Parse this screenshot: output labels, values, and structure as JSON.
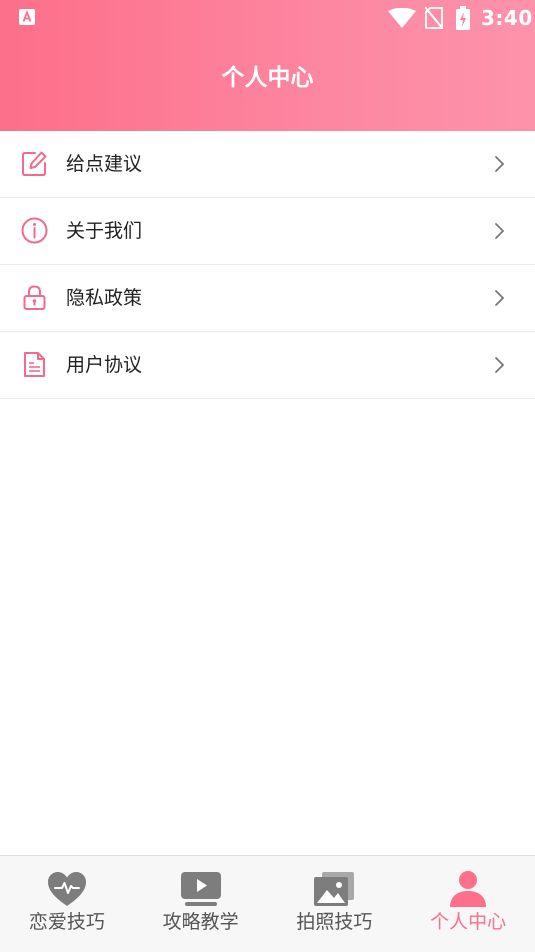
{
  "status_bar": {
    "time": "3:40",
    "app_icon": "app-a-icon",
    "wifi_icon": "wifi-icon",
    "sim_icon": "no-sim-icon",
    "battery_icon": "battery-charging-icon"
  },
  "header": {
    "title": "个人中心",
    "gradient_start": "#fd6f8a",
    "gradient_end": "#fd93ab"
  },
  "menu": {
    "items": [
      {
        "label": "给点建议",
        "icon": "edit-icon"
      },
      {
        "label": "关于我们",
        "icon": "info-icon"
      },
      {
        "label": "隐私政策",
        "icon": "lock-icon"
      },
      {
        "label": "用户协议",
        "icon": "document-icon"
      }
    ],
    "icon_color": "#f36b8c"
  },
  "tabbar": {
    "tabs": [
      {
        "label": "恋爱技巧",
        "icon": "heart-pulse-icon",
        "active": false
      },
      {
        "label": "攻略教学",
        "icon": "play-video-icon",
        "active": false
      },
      {
        "label": "拍照技巧",
        "icon": "photo-gallery-icon",
        "active": false
      },
      {
        "label": "个人中心",
        "icon": "person-icon",
        "active": true
      }
    ],
    "active_color": "#fd6f8a",
    "inactive_color": "#555555"
  }
}
